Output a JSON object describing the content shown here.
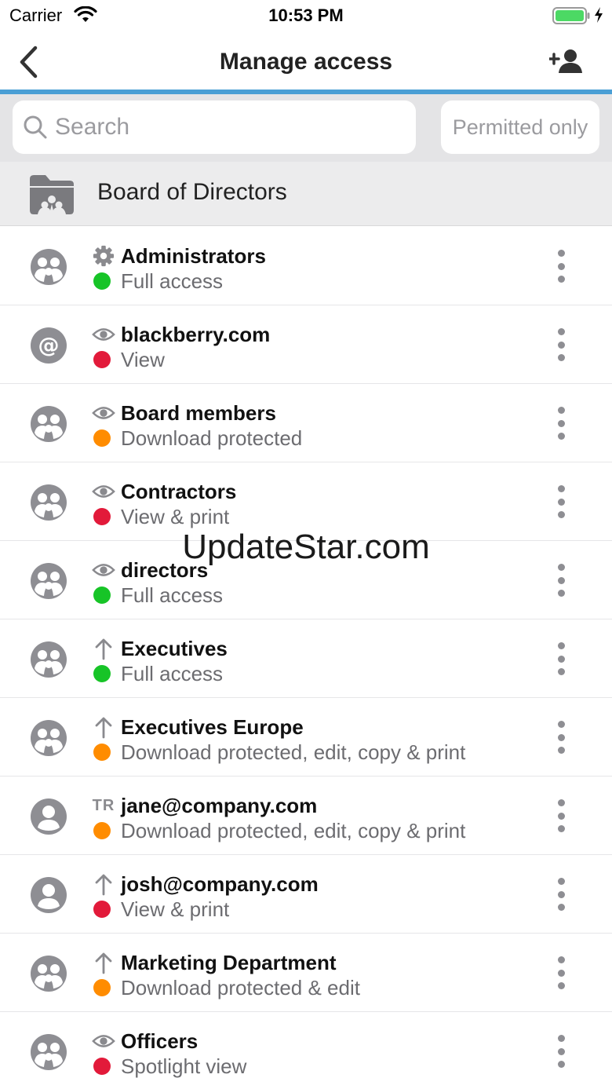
{
  "status_bar": {
    "carrier": "Carrier",
    "time": "10:53 PM"
  },
  "nav": {
    "title": "Manage access",
    "back_icon": "chevron-left-icon",
    "add_icon": "add-user-icon"
  },
  "search": {
    "placeholder": "Search",
    "value": "",
    "filter_label": "Permitted only"
  },
  "folder": {
    "name": "Board of Directors",
    "icon": "shared-folder-icon"
  },
  "colors": {
    "accent": "#4a9fd5",
    "full": "#17c427",
    "restricted": "#e21a3a",
    "protected": "#ff8c00"
  },
  "entries": [
    {
      "name": "Administrators",
      "permission": "Full access",
      "status": "full",
      "avatar": "group",
      "type": "gear"
    },
    {
      "name": "blackberry.com",
      "permission": "View",
      "status": "restricted",
      "avatar": "domain",
      "type": "eye"
    },
    {
      "name": "Board members",
      "permission": "Download protected",
      "status": "protected",
      "avatar": "group",
      "type": "eye"
    },
    {
      "name": "Contractors",
      "permission": "View & print",
      "status": "restricted",
      "avatar": "group",
      "type": "eye"
    },
    {
      "name": "directors",
      "permission": "Full access",
      "status": "full",
      "avatar": "group",
      "type": "eye"
    },
    {
      "name": "Executives",
      "permission": "Full access",
      "status": "full",
      "avatar": "group",
      "type": "arrow"
    },
    {
      "name": "Executives Europe",
      "permission": "Download protected, edit, copy & print",
      "status": "protected",
      "avatar": "group",
      "type": "arrow"
    },
    {
      "name": "jane@company.com",
      "permission": "Download protected, edit, copy & print",
      "status": "protected",
      "avatar": "user",
      "type": "text",
      "type_text": "TR"
    },
    {
      "name": "josh@company.com",
      "permission": "View & print",
      "status": "restricted",
      "avatar": "user",
      "type": "arrow"
    },
    {
      "name": "Marketing Department",
      "permission": "Download protected & edit",
      "status": "protected",
      "avatar": "group",
      "type": "arrow"
    },
    {
      "name": "Officers",
      "permission": "Spotlight view",
      "status": "restricted",
      "avatar": "group",
      "type": "eye"
    }
  ],
  "watermark": "UpdateStar.com"
}
